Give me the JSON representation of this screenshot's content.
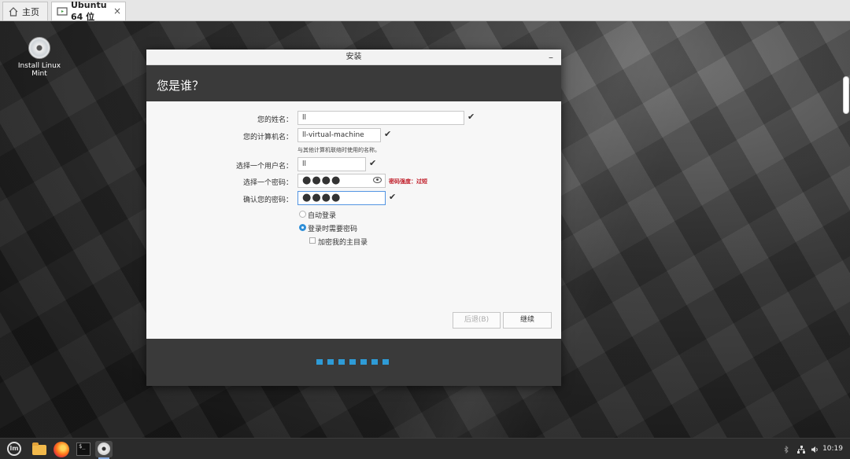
{
  "vm_tabs": {
    "home_label": "主页",
    "active_label": "Ubuntu 64 位",
    "close_glyph": "×"
  },
  "desktop": {
    "icon_label": "Install Linux Mint"
  },
  "window": {
    "title": "安装",
    "minimize_glyph": "–",
    "header": "您是谁？",
    "form": {
      "name_label": "您的姓名：",
      "name_value": "ll",
      "computer_label": "您的计算机名：",
      "computer_value": "ll-virtual-machine",
      "computer_hint": "与其他计算机联络时使用的名称。",
      "username_label": "选择一个用户名：",
      "username_value": "ll",
      "password_label": "选择一个密码：",
      "password_value": "●●●●",
      "password_strength": "密码强度：过短",
      "confirm_label": "确认您的密码：",
      "confirm_value": "●●●●",
      "check_glyph": "✔"
    },
    "options": {
      "auto_login": "自动登录",
      "require_password": "登录时需要密码",
      "encrypt_home": "加密我的主目录"
    },
    "buttons": {
      "back": "后退(B)",
      "continue": "继续"
    }
  },
  "taskbar": {
    "mint_logo": "lm",
    "terminal_prompt": "$_",
    "clock": "10:19"
  },
  "colors": {
    "accent": "#2e9bd6",
    "header_bg": "#3a3a3a",
    "warning": "#c01c28"
  }
}
